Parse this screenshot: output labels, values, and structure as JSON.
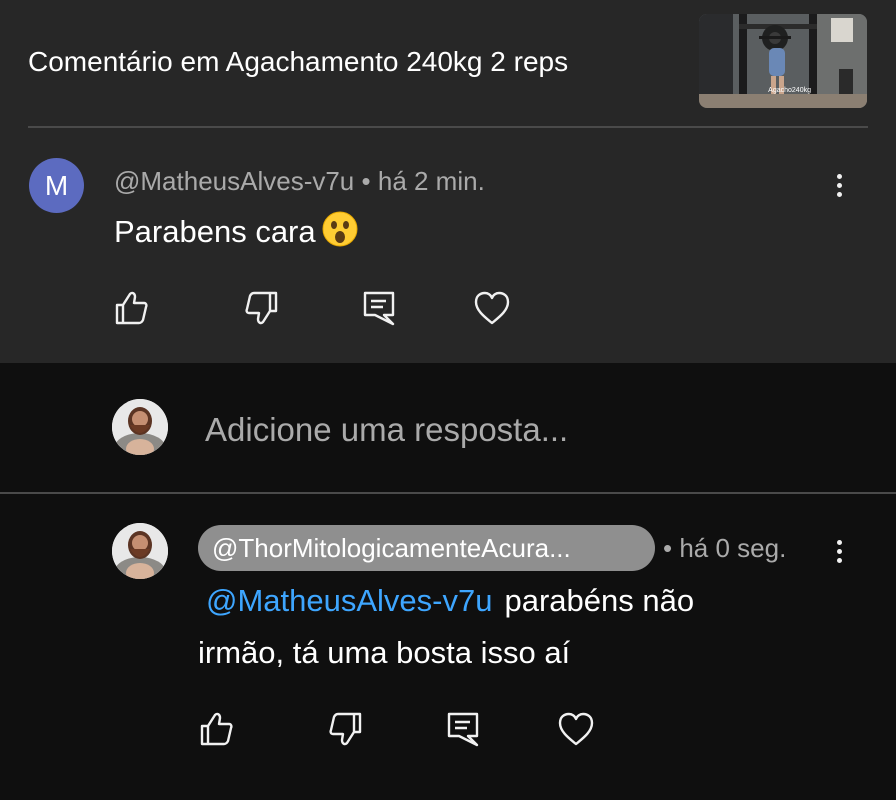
{
  "header": {
    "title": "Comentário em Agachamento 240kg 2 reps",
    "thumbnail_label": "Agacho240kg"
  },
  "comment": {
    "avatar_letter": "M",
    "author": "@MatheusAlves-v7u",
    "time": "há 2 min.",
    "separator": "•",
    "text": "Parabens cara",
    "emoji": "surprised-face-emoji"
  },
  "reply_box": {
    "placeholder": "Adicione uma resposta..."
  },
  "reply": {
    "author": "@ThorMitologicamenteAcura...",
    "separator": "•",
    "time": "há 0 seg.",
    "mention": "@MatheusAlves-v7u",
    "text_line1": "parabéns não",
    "text_line2": "irmão, tá uma bosta isso aí"
  },
  "actions": [
    "like-icon",
    "dislike-icon",
    "reply-icon",
    "heart-icon"
  ],
  "colors": {
    "top_bg": "#272727",
    "page_bg": "#0f0f0f",
    "mention": "#3ea6ff",
    "avatar_m": "#5c6bc0",
    "chip": "#8f8f8f"
  }
}
